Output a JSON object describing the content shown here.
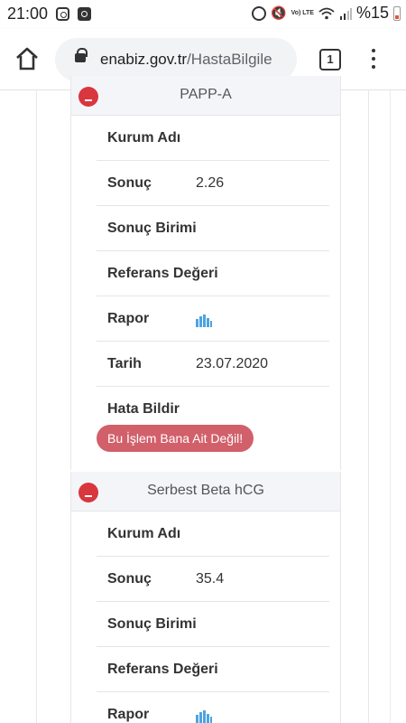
{
  "status_bar": {
    "time": "21:00",
    "battery_text": "%15",
    "volte_text": "Vo) LTE"
  },
  "browser": {
    "url_domain": "enabiz.gov.tr",
    "url_path": "/HastaBilgile",
    "tab_count": "1"
  },
  "labels": {
    "kurum": "Kurum Adı",
    "sonuc": "Sonuç",
    "birim": "Sonuç Birimi",
    "referans": "Referans Değeri",
    "rapor": "Rapor",
    "tarih": "Tarih",
    "hata": "Hata Bildir",
    "hata_button": "Bu İşlem Bana Ait Değil!"
  },
  "results": [
    {
      "title": "PAPP-A",
      "kurum": "",
      "sonuc": "2.26",
      "birim": "",
      "referans": "",
      "tarih": "23.07.2020"
    },
    {
      "title": "Serbest Beta hCG",
      "kurum": "",
      "sonuc": "35.4",
      "birim": "",
      "referans": ""
    }
  ],
  "colors": {
    "accent_red": "#d9363e",
    "button_red": "#d1606a",
    "chart_blue": "#4ea3e0"
  },
  "icons": {
    "home": "home-icon",
    "lock": "lock-icon",
    "menu": "more-vert-icon",
    "collapse": "minus-circle-icon",
    "report": "bar-chart-icon"
  }
}
